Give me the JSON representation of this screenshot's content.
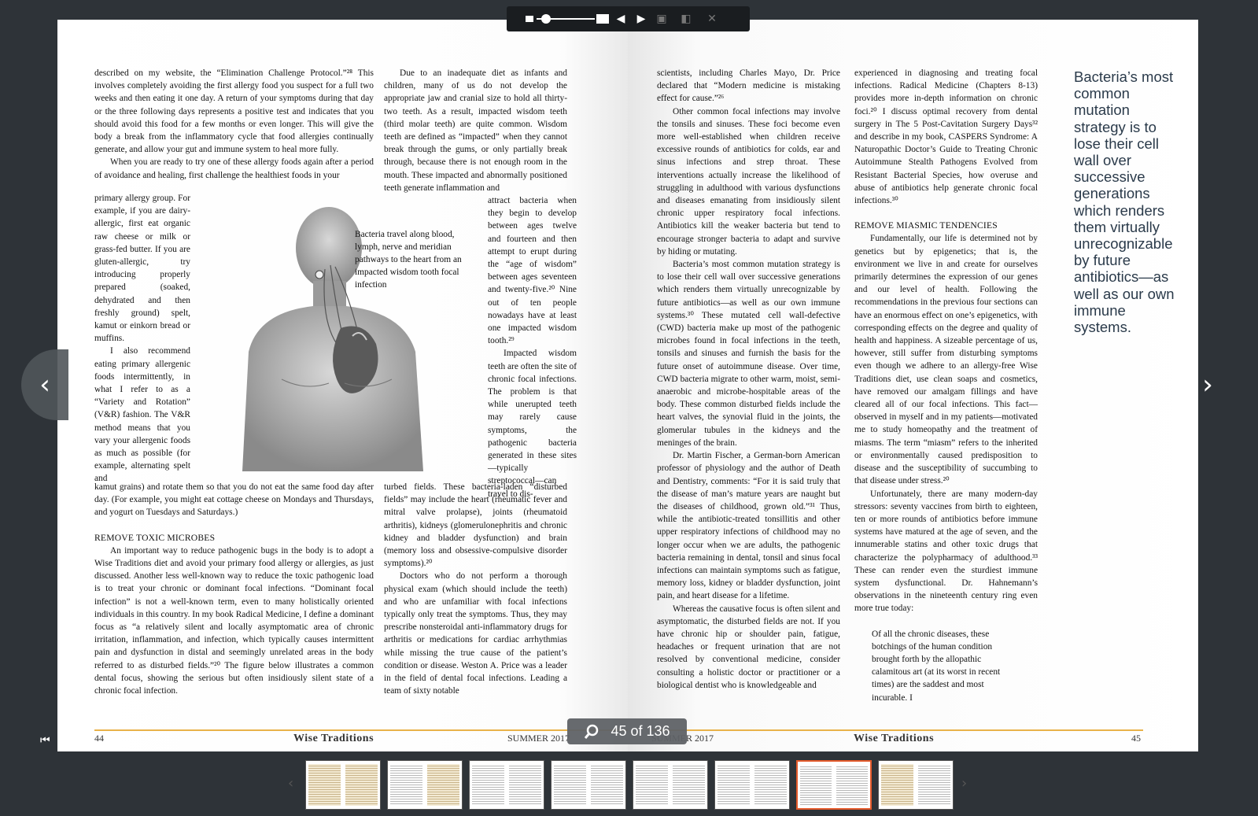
{
  "viewer": {
    "page_indicator": "45 of 136",
    "zoom_level": 0.1
  },
  "left_page": {
    "col1_top": [
      "described on my website, the “Elimination Challenge Protocol.”²⁸ This involves completely avoiding the first allergy food you suspect for a full two weeks and then eating it one day. A return of your symptoms during that day or the three following days represents a positive test and indicates that you should avoid this food for a few months or even longer. This will give the body a break from the inflammatory cycle that food allergies continually generate, and allow your gut and immune system to heal more fully.",
      "When you are ready to try one of these allergy foods again after a period of avoidance and healing, first challenge the healthiest foods in your"
    ],
    "col1_wrap": "primary allergy group. For example, if you are dairy-allergic, first eat organic raw cheese or milk or grass-fed butter. If you are gluten-allergic, try introducing properly prepared (soaked, dehydrated and then freshly ground) spelt, kamut or einkorn bread or muffins.",
    "col1_wrap2": "I also recommend eating primary allergenic foods intermittently, in what I refer to as a “Variety and Rotation” (V&R) fashion. The V&R method means that you vary your allergenic foods as much as possible (for example, alternating spelt and",
    "col1_bottom": "kamut grains) and rotate them so that you do not eat the same food day after day. (For example, you might eat cottage cheese on Mondays and Thursdays, and yogurt on Tuesdays and Saturdays.)",
    "heading": "REMOVE TOXIC MICROBES",
    "col1_after": "An important way to reduce pathogenic bugs in the body is to adopt a Wise Traditions diet and avoid your primary food allergy or allergies, as just discussed. Another less well-known way to reduce the toxic pathogenic load is to treat your chronic or dominant focal infections. “Dominant focal infection” is not a well-known term, even to many holistically oriented individuals in this country. In my book Radical Medicine, I define a dominant focus as “a relatively silent and locally asymptomatic area of chronic irritation, inflammation, and infection, which typically causes intermittent pain and dysfunction in distal and seemingly unrelated areas in the body referred to as disturbed fields.”²⁰ The figure below illustrates a common dental focus, showing the serious but often insidiously silent state of a chronic focal infection.",
    "col2_top": "Due to an inadequate diet as infants and children, many of us do not develop the appropriate jaw and cranial size to hold all thirty-two teeth. As a result, impacted wisdom teeth (third molar teeth) are quite common. Wisdom teeth are defined as “impacted” when they cannot break through the gums, or only partially break through, because there is not enough room in the mouth. These impacted and abnormally positioned teeth generate inflammation and",
    "col2_wrap": "attract bacteria when they begin to develop between ages twelve and fourteen and then attempt to erupt during the “age of wisdom” between ages seventeen and twenty-five.²⁰ Nine out of ten people nowadays have at least one impacted wisdom tooth.²⁹",
    "col2_wrap2": "Impacted wisdom teeth are often the site of chronic focal infections. The problem is that while unerupted teeth may rarely cause symptoms, the pathogenic bacteria generated in these sites—typically streptococcal—can travel to dis-",
    "col2_bottom": "turbed fields. These bacteria-laden “disturbed fields” may include the heart (rheumatic fever and mitral valve prolapse), joints (rheumatoid arthritis), kidneys (glomerulonephritis and chronic kidney and bladder dysfunction) and brain (memory loss and obsessive-compulsive disorder symptoms).²⁰",
    "col2_after": "Doctors who do not perform a thorough physical exam (which should include the teeth) and who are unfamiliar with focal infections typically only treat the symptoms. Thus, they may prescribe nonsteroidal anti-inflammatory drugs for arthritis or medications for cardiac arrhythmias while missing the true cause of the patient’s condition or disease. Weston A. Price was a leader in the field of dental focal infections. Leading a team of sixty notable",
    "figure_caption": "Bacteria travel along blood, lymph, nerve and meridian pathways to the heart from an impacted wisdom tooth focal infection",
    "page_number": "44",
    "brand": "Wise Traditions",
    "issue": "SUMMER 2017"
  },
  "right_page": {
    "col1": [
      "scientists, including Charles Mayo, Dr. Price declared that “Modern medicine is mistaking effect for cause.”²⁶",
      "Other common focal infections may involve the tonsils and sinuses. These foci become even more well-established when children receive excessive rounds of antibiotics for colds, ear and sinus infections and strep throat. These interventions actually increase the likelihood of struggling in adulthood with various dysfunctions and diseases emanating from insidiously silent chronic upper respiratory focal infections. Antibiotics kill the weaker bacteria but tend to encourage stronger bacteria to adapt and survive by hiding or mutating.",
      "Bacteria’s most common mutation strategy is to lose their cell wall over successive generations which renders them virtually unrecognizable by future antibiotics—as well as our own immune systems.³⁰ These mutated cell wall-defective (CWD) bacteria make up most of the pathogenic microbes found in focal infections in the teeth, tonsils and sinuses and furnish the basis for the future onset of autoimmune disease. Over time, CWD bacteria migrate to other warm, moist, semi-anaerobic and microbe-hospitable areas of the body. These common disturbed fields include the heart valves, the synovial fluid in the joints, the glomerular tubules in the kidneys and the meninges of the brain.",
      "Dr. Martin Fischer, a German-born American professor of physiology and the author of Death and Dentistry, comments: “For it is said truly that the disease of man’s mature years are naught but the diseases of childhood, grown old.”³¹ Thus, while the antibiotic-treated tonsillitis and other upper respiratory infections of childhood may no longer occur when we are adults, the pathogenic bacteria remaining in dental, tonsil and sinus focal infections can maintain symptoms such as fatigue, memory loss, kidney or bladder dysfunction, joint pain, and heart disease for a lifetime.",
      "Whereas the causative focus is often silent and asymptomatic, the disturbed fields are not. If you have chronic hip or shoulder pain, fatigue, headaches or frequent urination that are not resolved by conventional medicine, consider consulting a holistic doctor or practitioner or a biological dentist who is knowledgeable and"
    ],
    "col2_top": "experienced in diagnosing and treating focal infections. Radical Medicine (Chapters 8-13) provides more in-depth information on chronic foci.²⁰ I discuss optimal recovery from dental surgery in The 5 Post-Cavitation Surgery Days³² and describe in my book, CASPERS Syndrome: A Naturopathic Doctor’s Guide to Treating Chronic Autoimmune Stealth Pathogens Evolved from Resistant Bacterial Species, how overuse and abuse of antibiotics help generate chronic focal infections.³⁰",
    "heading": "REMOVE MIASMIC TENDENCIES",
    "col2_rest": [
      "Fundamentally, our life is determined not by genetics but by epigenetics; that is, the environment we live in and create for ourselves primarily determines the expression of our genes and our level of health. Following the recommendations in the previous four sections can have an enormous effect on one’s epigenetics, with corresponding effects on the degree and quality of health and happiness. A sizeable percentage of us, however, still suffer from disturbing symptoms even though we adhere to an allergy-free Wise Traditions diet, use clean soaps and cosmetics, have removed our amalgam fillings and have cleared all of our focal infections. This fact—observed in myself and in my patients—motivated me to study homeopathy and the treatment of miasms. The term “miasm” refers to the inherited or environmentally caused predisposition to disease and the susceptibility of succumbing to that disease under stress.²⁰",
      "Unfortunately, there are many modern-day stressors: seventy vaccines from birth to eighteen, ten or more rounds of antibiotics before immune systems have matured at the age of seven, and the innumerable statins and other toxic drugs that characterize the polypharmacy of adulthood.³³ These can render even the sturdiest immune system dysfunctional. Dr. Hahnemann’s observations in the nineteenth century ring even more true today:"
    ],
    "quote": "Of all the chronic diseases, these botchings of the human condition brought forth by the allopathic calamitous art (at its worst in recent times) are the saddest and most incurable. I",
    "pull_quote": "Bacteria’s most common mutation strategy is to lose their cell wall over successive generations which renders them virtually unrecognizable by future antibiotics—as well as our own immune systems.",
    "page_number": "45",
    "brand": "Wise Traditions",
    "issue": "SUMMER 2017"
  },
  "thumbnails": [
    "thumb-1",
    "thumb-2",
    "thumb-3",
    "thumb-4",
    "thumb-5",
    "thumb-6",
    "thumb-7",
    "thumb-8"
  ],
  "active_thumbnail_index": 6,
  "colors": {
    "background": "#2e3338",
    "rule": "#e9b24a",
    "active_thumb": "#e55a2b"
  }
}
